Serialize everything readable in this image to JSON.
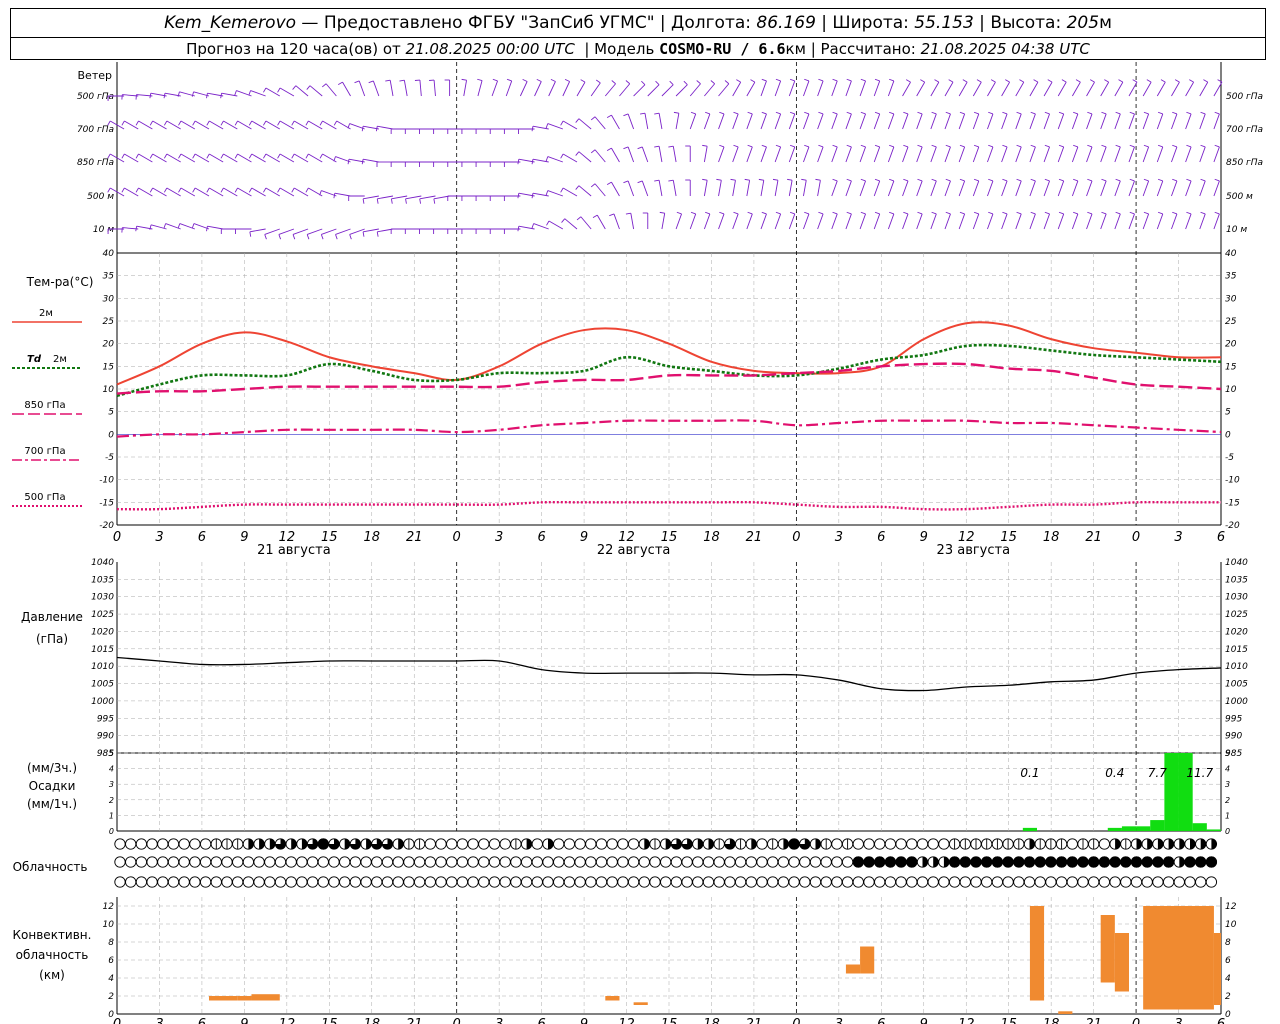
{
  "header": {
    "station": "Kem_Kemerovo",
    "provider": " — Предоставлено ФГБУ \"ЗапСиб УГМС\" | Долгота: ",
    "lon": "86.169",
    "lat_label": " | Широта: ",
    "lat": "55.153",
    "alt_label": " | Высота: ",
    "alt": "205",
    "alt_unit": "м",
    "forecast_label": "Прогноз на 120 часа(ов) от ",
    "init_time": "21.08.2025 00:00 UTC",
    "model_label": "  | Модель ",
    "model": "COSMO-RU / 6.6",
    "model_unit": "км",
    "calc_label": " | Рассчитано: ",
    "calc_time": "21.08.2025 04:38 UTC"
  },
  "labels": {
    "wind": "Ветер",
    "levels": [
      "500 гПа",
      "700 гПа",
      "850 гПа",
      "500  м",
      "10  м"
    ],
    "temp_title": "Тем-ра(°С)",
    "t2m": "2м",
    "td": "Td",
    "td2m": "2м",
    "t850": "850 гПа",
    "t700": "700 гПа",
    "t500": "500 гПа",
    "pressure": "Давление",
    "pressure_unit": "(гПа)",
    "precip3": "(мм/3ч.)",
    "precip": "Осадки",
    "precip1": "(мм/1ч.)",
    "cloud": "Облачность",
    "conv1": "Конвективн.",
    "conv2": "облачность",
    "conv3": "(км)"
  },
  "colors": {
    "wind": "#7a22c8",
    "t2m": "#ee4433",
    "td2m": "#117711",
    "t850": "#e0106e",
    "t700": "#e0106e",
    "t500": "#e0106e",
    "pressure": "#000000",
    "precip": "#11dd11",
    "conv": "#f08a30",
    "grid": "#aaaaaa",
    "zero_line": "#3333cc"
  },
  "axes": {
    "x_hours": [
      0,
      3,
      6,
      9,
      12,
      15,
      18,
      21,
      0,
      3,
      6,
      9,
      12,
      15,
      18,
      21,
      0,
      3,
      6,
      9,
      12,
      15,
      18,
      21,
      0,
      3,
      6
    ],
    "dates": [
      {
        "text": "21 августа",
        "hour": 12.5
      },
      {
        "text": "22 августа",
        "hour": 36.5
      },
      {
        "text": "23 августа",
        "hour": 60.5
      }
    ],
    "temp_ticks": [
      40,
      35,
      30,
      25,
      20,
      15,
      10,
      5,
      0,
      -5,
      -10,
      -15,
      -20
    ],
    "press_ticks": [
      1040,
      1035,
      1030,
      1025,
      1020,
      1015,
      1010,
      1005,
      1000,
      995,
      990,
      985
    ],
    "precip_ticks": [
      5,
      4,
      3,
      2,
      1,
      0
    ],
    "conv_ticks": [
      12,
      10,
      8,
      6,
      4,
      2,
      0
    ]
  },
  "chart_data": [
    {
      "type": "line",
      "title": "Тем-ра(°С)",
      "xlabel": "",
      "ylabel": "",
      "x_range": [
        0,
        78
      ],
      "ylim": [
        -20,
        40
      ],
      "x": [
        0,
        3,
        6,
        9,
        12,
        15,
        18,
        21,
        24,
        27,
        30,
        33,
        36,
        39,
        42,
        45,
        48,
        51,
        54,
        57,
        60,
        63,
        66,
        69,
        72,
        75,
        78
      ],
      "series": [
        {
          "name": "2м",
          "values": [
            11,
            15,
            20,
            22.5,
            20.5,
            17,
            15,
            13.5,
            12,
            15,
            20,
            23,
            23,
            20,
            16,
            14,
            13.5,
            13.5,
            15,
            21,
            24.5,
            24,
            21,
            19,
            18,
            17,
            17
          ]
        },
        {
          "name": "Td 2м",
          "values": [
            8.5,
            11,
            13,
            13,
            13,
            15.5,
            14,
            12,
            12,
            13.5,
            13.5,
            14,
            17,
            15,
            14,
            13,
            13,
            14.5,
            16.5,
            17.5,
            19.5,
            19.5,
            18.5,
            17.5,
            17,
            16.5,
            16
          ]
        },
        {
          "name": "850 гПа",
          "values": [
            9,
            9.5,
            9.5,
            10,
            10.5,
            10.5,
            10.5,
            10.5,
            10.5,
            10.5,
            11.5,
            12,
            12,
            13,
            13,
            13,
            13.5,
            14,
            15,
            15.5,
            15.5,
            14.5,
            14,
            12.5,
            11,
            10.5,
            10
          ]
        },
        {
          "name": "700 гПа",
          "values": [
            -0.5,
            0,
            0,
            0.5,
            1,
            1,
            1,
            1,
            0.5,
            1,
            2,
            2.5,
            3,
            3,
            3,
            3,
            2,
            2.5,
            3,
            3,
            3,
            2.5,
            2.5,
            2,
            1.5,
            1,
            0.5
          ]
        },
        {
          "name": "500 гПа",
          "values": [
            -16.5,
            -16.5,
            -16,
            -15.5,
            -15.5,
            -15.5,
            -15.5,
            -15.5,
            -15.5,
            -15.5,
            -15,
            -15,
            -15,
            -15,
            -15,
            -15,
            -15.5,
            -16,
            -16,
            -16.5,
            -16.5,
            -16,
            -15.5,
            -15.5,
            -15,
            -15,
            -15
          ]
        }
      ]
    },
    {
      "type": "line",
      "title": "Давление",
      "ylabel": "(гПа)",
      "x_range": [
        0,
        78
      ],
      "ylim": [
        985,
        1040
      ],
      "x": [
        0,
        3,
        6,
        9,
        12,
        15,
        18,
        21,
        24,
        27,
        30,
        33,
        36,
        39,
        42,
        45,
        48,
        51,
        54,
        57,
        60,
        63,
        66,
        69,
        72,
        75,
        78
      ],
      "series": [
        {
          "name": "Давление",
          "values": [
            1012.5,
            1011.5,
            1010.5,
            1010.5,
            1011,
            1011.5,
            1011.5,
            1011.5,
            1011.5,
            1011.5,
            1009,
            1008,
            1008,
            1008,
            1008,
            1007.5,
            1007.5,
            1006,
            1003.5,
            1003,
            1004,
            1004.5,
            1005.5,
            1006,
            1008,
            1009,
            1009.5
          ]
        }
      ]
    },
    {
      "type": "bar",
      "title": "Осадки",
      "ylabel": "(мм/1ч.)",
      "x_range": [
        0,
        78
      ],
      "ylim": [
        0,
        5
      ],
      "x": [
        64.5,
        70.5,
        71.5,
        72.5,
        73.5,
        74.5,
        75.5,
        76.5,
        77.5
      ],
      "values": [
        0.2,
        0.2,
        0.3,
        0.3,
        0.7,
        5,
        5,
        0.5,
        0.1
      ],
      "annotations": [
        {
          "text": "0.1",
          "hour": 64.5
        },
        {
          "text": "0.4",
          "hour": 70.5
        },
        {
          "text": "7.7",
          "hour": 73.5
        },
        {
          "text": "11.7",
          "hour": 76.5
        }
      ]
    },
    {
      "type": "bar",
      "title": "Конвективн. облачность",
      "ylabel": "(км)",
      "x_range": [
        0,
        78
      ],
      "ylim": [
        0,
        13
      ],
      "bars": [
        {
          "x": [
            6.5,
            8.5
          ],
          "bottom": 1.5,
          "top": 2
        },
        {
          "x": [
            8.5,
            9.5
          ],
          "bottom": 1.5,
          "top": 2
        },
        {
          "x": [
            9.5,
            11.5
          ],
          "bottom": 1.5,
          "top": 2.2
        },
        {
          "x": [
            34.5,
            35.5
          ],
          "bottom": 1.5,
          "top": 2
        },
        {
          "x": [
            36.5,
            37.5
          ],
          "bottom": 1,
          "top": 1.3
        },
        {
          "x": [
            51.5,
            52.5
          ],
          "bottom": 4.5,
          "top": 5.5
        },
        {
          "x": [
            52.5,
            53.5
          ],
          "bottom": 4.5,
          "top": 7.5
        },
        {
          "x": [
            64.5,
            65.5
          ],
          "bottom": 1.5,
          "top": 12
        },
        {
          "x": [
            66.5,
            67.5
          ],
          "bottom": 0,
          "top": 0.3
        },
        {
          "x": [
            69.5,
            70.5
          ],
          "bottom": 3.5,
          "top": 11
        },
        {
          "x": [
            70.5,
            71.5
          ],
          "bottom": 2.5,
          "top": 9
        },
        {
          "x": [
            72.5,
            77.5
          ],
          "bottom": 0.5,
          "top": 12
        },
        {
          "x": [
            77.5,
            78
          ],
          "bottom": 1,
          "top": 9
        }
      ]
    }
  ],
  "clouds": {
    "low": "000000000111222322343232332110000000012020000000021233221312012432101000000000111111121110110212222222222",
    "mid": "00000000000000000000000000000000000000000000000000000000000000000000044444422244444444444444444444424444444444444",
    "high": "00000000000000000000000000000000000000000000000000000000000000000000000000000000000000000000000000000000000000000"
  },
  "wind": {
    "comment_free": true,
    "rows": [
      {
        "level": "500 гПа",
        "dirs": [
          270,
          275,
          275,
          280,
          280,
          285,
          285,
          280,
          280,
          290,
          290,
          300,
          300,
          310,
          310,
          320,
          330,
          340,
          340,
          350,
          350,
          355,
          355,
          360,
          10,
          15,
          20,
          20,
          25,
          25,
          25,
          25,
          30,
          35,
          40,
          40,
          45,
          45,
          45,
          45,
          40,
          40,
          40,
          30,
          30,
          20,
          20,
          20,
          20,
          20,
          20,
          20,
          20,
          20,
          20,
          30,
          30,
          30,
          30,
          30,
          30,
          30,
          30,
          30,
          30,
          30,
          30,
          30,
          30,
          30,
          30,
          30,
          30,
          30,
          30,
          30,
          30,
          30
        ]
      },
      {
        "level": "700 гПа",
        "dirs": [
          300,
          300,
          300,
          300,
          300,
          300,
          300,
          300,
          300,
          300,
          300,
          300,
          300,
          300,
          300,
          300,
          300,
          290,
          280,
          280,
          270,
          270,
          270,
          270,
          270,
          270,
          270,
          270,
          270,
          270,
          280,
          290,
          300,
          310,
          320,
          330,
          340,
          350,
          350,
          10,
          20,
          20,
          20,
          20,
          20,
          20,
          20,
          20,
          20,
          20,
          20,
          20,
          20,
          20,
          20,
          20,
          20,
          20,
          20,
          20,
          20,
          20,
          20,
          20,
          20,
          20,
          20,
          20,
          20,
          20,
          20,
          20,
          20,
          20,
          20,
          20,
          20,
          20
        ]
      },
      {
        "level": "850 гПа",
        "dirs": [
          300,
          300,
          300,
          300,
          300,
          300,
          300,
          300,
          300,
          300,
          300,
          300,
          300,
          300,
          300,
          300,
          290,
          280,
          280,
          270,
          270,
          270,
          270,
          270,
          270,
          270,
          270,
          270,
          270,
          280,
          280,
          290,
          300,
          310,
          320,
          330,
          340,
          340,
          350,
          350,
          360,
          10,
          20,
          20,
          20,
          20,
          20,
          20,
          20,
          20,
          20,
          20,
          20,
          20,
          20,
          20,
          20,
          20,
          20,
          20,
          20,
          20,
          20,
          20,
          20,
          20,
          20,
          20,
          20,
          20,
          20,
          20,
          20,
          20,
          20,
          20,
          20,
          20
        ]
      },
      {
        "level": "500  м",
        "dirs": [
          300,
          300,
          300,
          300,
          300,
          300,
          300,
          300,
          300,
          300,
          300,
          300,
          300,
          300,
          300,
          290,
          280,
          270,
          260,
          260,
          260,
          260,
          260,
          260,
          270,
          270,
          270,
          270,
          270,
          280,
          280,
          290,
          300,
          310,
          320,
          330,
          340,
          340,
          350,
          350,
          360,
          10,
          10,
          10,
          10,
          10,
          10,
          10,
          10,
          10,
          20,
          20,
          20,
          20,
          20,
          20,
          20,
          20,
          20,
          20,
          20,
          20,
          20,
          20,
          20,
          20,
          20,
          20,
          20,
          20,
          20,
          20,
          20,
          20,
          20,
          20,
          20,
          20
        ]
      },
      {
        "level": "10  м",
        "dirs": [
          270,
          275,
          280,
          285,
          290,
          290,
          290,
          280,
          270,
          270,
          260,
          250,
          250,
          250,
          250,
          250,
          250,
          250,
          260,
          260,
          270,
          270,
          270,
          270,
          270,
          270,
          270,
          270,
          270,
          280,
          290,
          300,
          310,
          320,
          330,
          340,
          350,
          360,
          10,
          20,
          20,
          20,
          20,
          20,
          20,
          20,
          20,
          20,
          20,
          20,
          20,
          20,
          20,
          20,
          20,
          20,
          20,
          20,
          20,
          20,
          20,
          20,
          20,
          20,
          20,
          20,
          20,
          20,
          20,
          20,
          20,
          20,
          20,
          20,
          20,
          20,
          20,
          20
        ]
      }
    ]
  }
}
